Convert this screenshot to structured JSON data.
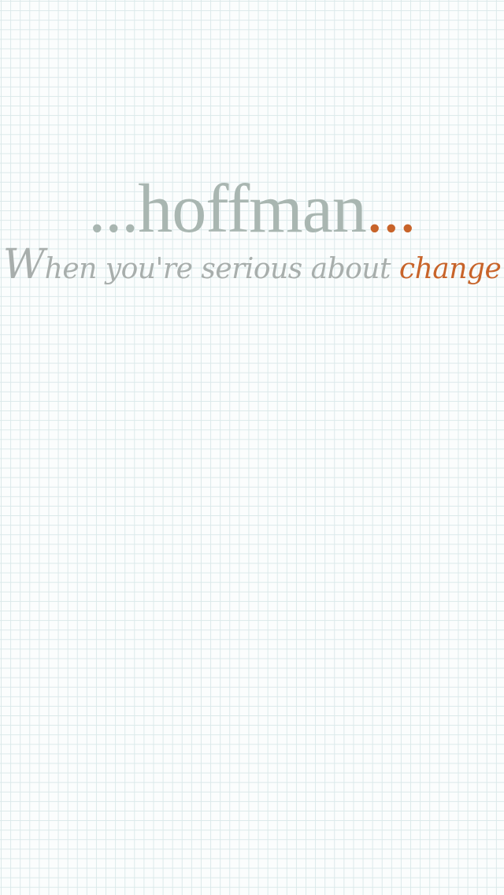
{
  "brand": {
    "lead_dots": "...",
    "name": "hoffman",
    "trail_dots": "..."
  },
  "tagline": {
    "first_letter": "W",
    "text": "hen you're serious about ",
    "accent_word": "change"
  },
  "colors": {
    "wordmark": "#a9b6b1",
    "accent": "#c8642a",
    "tagline": "#a8aeac",
    "grid_line": "#dbe9ea",
    "background": "#fbfdfd"
  }
}
